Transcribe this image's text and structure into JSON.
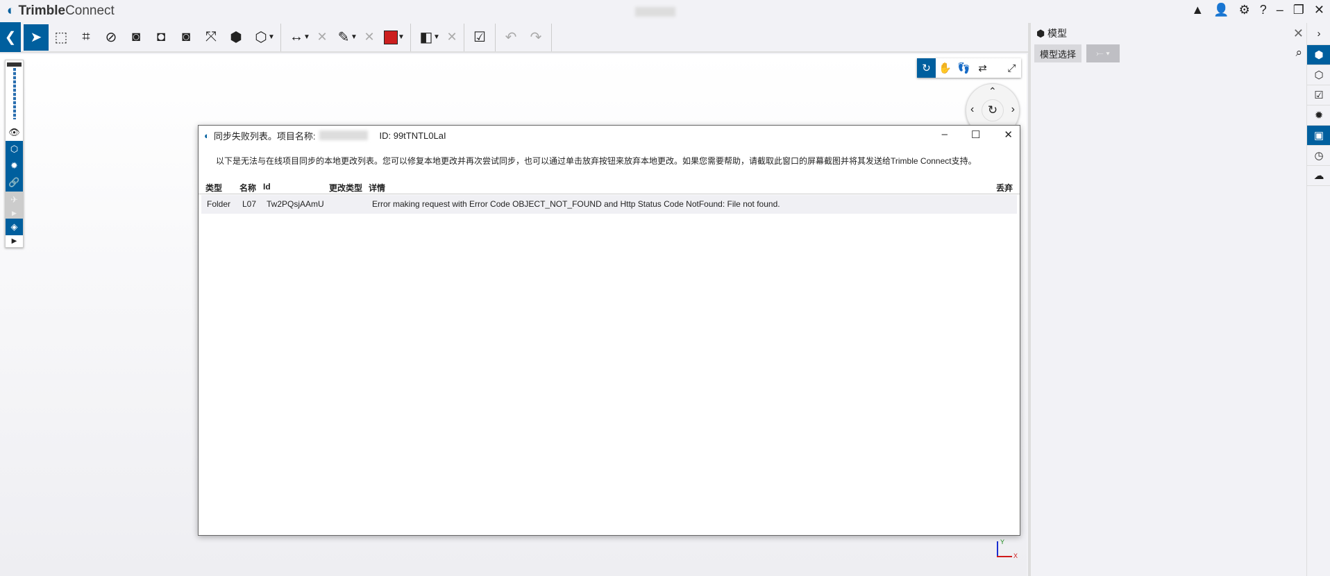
{
  "app": {
    "title_brand": "Trimble",
    "title_rest": " Connect"
  },
  "titlebar": {
    "icons": [
      "warning-icon",
      "user-icon",
      "gear-icon",
      "help-icon"
    ],
    "minimize": "–",
    "restore": "❐",
    "close": "✕"
  },
  "toolbar": {
    "color_swatch": "#cc1f1f",
    "accent": "#005f9e"
  },
  "dialog": {
    "title": "同步失败列表。项目名称:",
    "id_label": "ID: 99tTNTL0LaI",
    "intro": "以下是无法与在线项目同步的本地更改列表。您可以修复本地更改并再次尝试同步，也可以通过单击放弃按钮来放弃本地更改。如果您需要帮助，请截取此窗口的屏幕截图并将其发送给Trimble Connect支持。",
    "columns": {
      "type": "类型",
      "name": "名称",
      "id": "Id",
      "change_type": "更改类型",
      "details": "详情",
      "discard": "丢弃"
    },
    "rows": [
      {
        "type": "Folder",
        "name": "L07",
        "id": "Tw2PQsjAAmU",
        "change_type": "",
        "details": "Error making request with Error Code OBJECT_NOT_FOUND and Http Status Code NotFound: File not found."
      }
    ]
  },
  "right_panel": {
    "title": "模型",
    "model_select": "模型选择"
  },
  "axis": {
    "y": "Y",
    "x": "X"
  }
}
